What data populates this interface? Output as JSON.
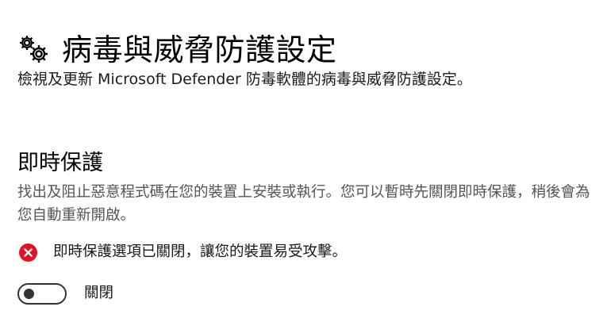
{
  "header": {
    "icon": "gear-icon",
    "title": "病毒與威脅防護設定"
  },
  "description": "檢視及更新 Microsoft Defender 防毒軟體的病毒與威脅防護設定。",
  "realtime_protection": {
    "title": "即時保護",
    "description": "找出及阻止惡意程式碼在您的裝置上安裝或執行。您可以暫時先關閉即時保護，稍後會為您自動重新開啟。",
    "warning": {
      "icon": "error-icon",
      "color": "#e81123",
      "text": "即時保護選項已關閉，讓您的裝置易受攻擊。"
    },
    "toggle": {
      "state": "off",
      "label": "關閉"
    }
  }
}
